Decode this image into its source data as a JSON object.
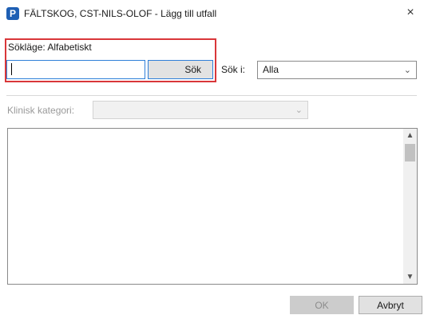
{
  "window": {
    "icon_letter": "P",
    "title": "FÄLTSKOG, CST-NILS-OLOF - Lägg till utfall",
    "close": "×"
  },
  "search": {
    "mode_label": "Sökläge: Alfabetiskt",
    "input_value": "",
    "button_label": "Sök",
    "search_in_label": "Sök i:",
    "search_in_value": "Alla"
  },
  "category": {
    "label": "Klinisk kategori:",
    "value": ""
  },
  "colors": {
    "highlight_border": "#d9373a",
    "focus_border": "#2f7fd8",
    "app_icon": "#1e5fb4"
  },
  "buttons": {
    "ok": "OK",
    "cancel": "Avbryt"
  }
}
